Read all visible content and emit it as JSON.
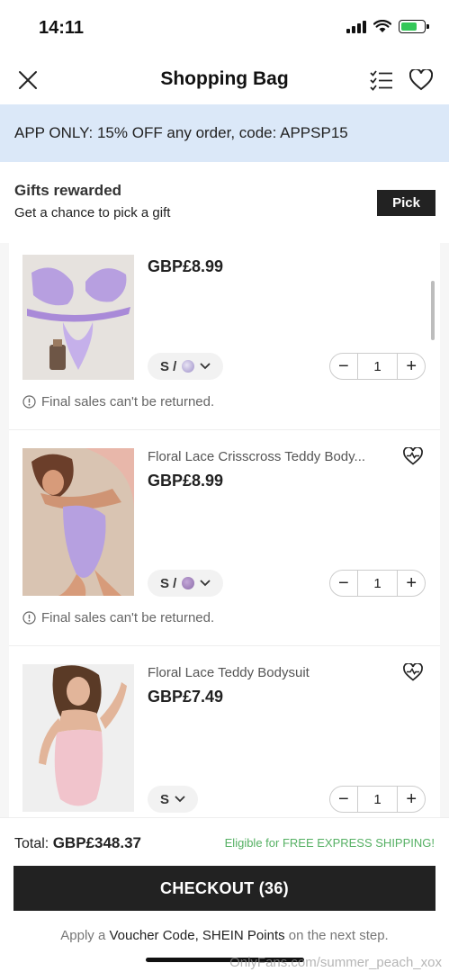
{
  "status_bar": {
    "time": "14:11"
  },
  "header": {
    "title": "Shopping Bag"
  },
  "promo": {
    "text": "APP ONLY: 15% OFF any order, code: APPSP15"
  },
  "gifts": {
    "title": "Gifts rewarded",
    "subtitle": "Get a chance to pick a gift",
    "button": "Pick"
  },
  "items": [
    {
      "name": "",
      "price": "GBP£8.99",
      "size": "S /",
      "swatch_color": "#9d8ec8",
      "quantity": "1",
      "note": "Final sales can't be returned."
    },
    {
      "name": "Floral Lace Crisscross Teddy Body...",
      "price": "GBP£8.99",
      "size": "S /",
      "swatch_color": "#8a6aa8",
      "quantity": "1",
      "note": "Final sales can't be returned."
    },
    {
      "name": "Floral Lace Teddy Bodysuit",
      "price": "GBP£7.49",
      "size": "S",
      "quantity": "1"
    }
  ],
  "footer": {
    "total_label": "Total:",
    "total_value": "GBP£348.37",
    "free_shipping": "Eligible for FREE EXPRESS SHIPPING!",
    "checkout": "CHECKOUT (36)",
    "apply_prefix": "Apply a",
    "voucher": "Voucher Code,",
    "points": "SHEIN Points",
    "apply_suffix": "on the next step.",
    "watermark": "OnlyFans.com/summer_peach_xox"
  },
  "colors": {
    "promo_bg": "#dbe8f8",
    "accent_dark": "#222222",
    "free_ship_green": "#55b063"
  }
}
